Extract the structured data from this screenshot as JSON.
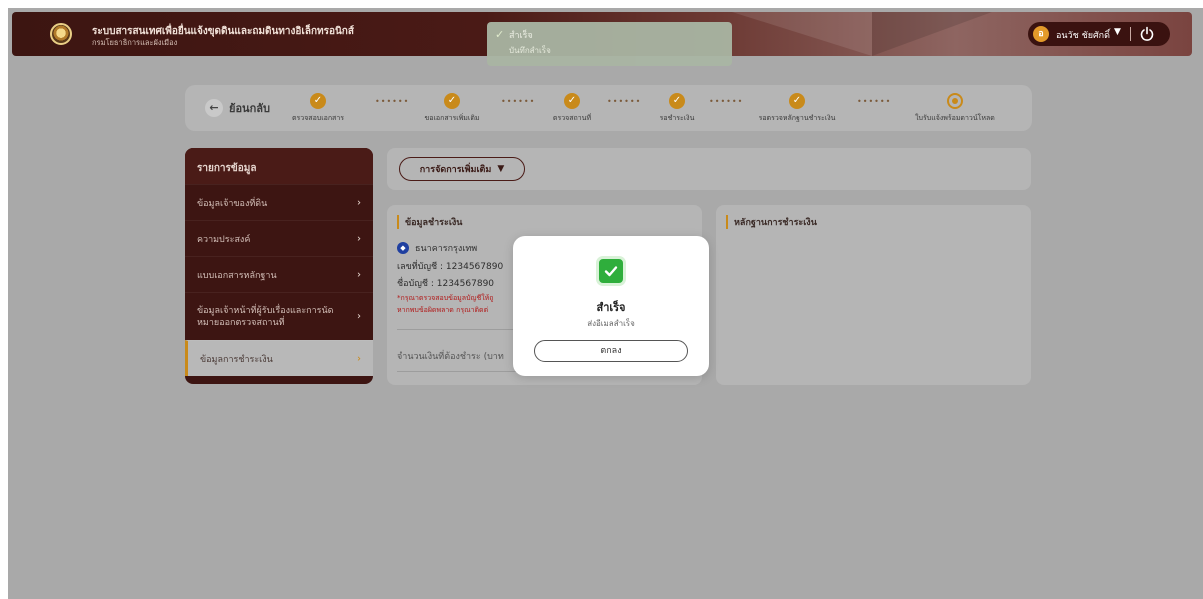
{
  "header": {
    "title": "ระบบสารสนเทศเพื่อยื่นแจ้งขุดดินและถมดินทางอิเล็กทรอนิกส์",
    "subtitle": "กรมโยธาธิการและผังเมือง",
    "user_initial": "อ",
    "user_name": "อนวัช ชัยศักดิ์"
  },
  "toast": {
    "title": "สำเร็จ",
    "message": "บันทึกสำเร็จ"
  },
  "stepper": {
    "back_label": "ย้อนกลับ",
    "steps": [
      {
        "label": "ตรวจสอบเอกสาร",
        "status": "done"
      },
      {
        "label": "ขอเอกสารเพิ่มเติม",
        "status": "done"
      },
      {
        "label": "ตรวจสถานที่",
        "status": "done"
      },
      {
        "label": "รอชำระเงิน",
        "status": "done"
      },
      {
        "label": "รอตรวจหลักฐานชำระเงิน",
        "status": "done"
      },
      {
        "label": "ใบรับแจ้งพร้อมดาวน์โหลด",
        "status": "current"
      }
    ]
  },
  "sidebar": {
    "heading": "รายการข้อมูล",
    "items": [
      {
        "label": "ข้อมูลเจ้าของที่ดิน"
      },
      {
        "label": "ความประสงค์"
      },
      {
        "label": "แบบเอกสารหลักฐาน"
      },
      {
        "label": "ข้อมูลเจ้าหน้าที่ผู้รับเรื่องและการนัดหมายออกตรวจสถานที่"
      },
      {
        "label": "ข้อมูลการชำระเงิน",
        "active": true
      }
    ]
  },
  "actions": {
    "manage_label": "การจัดการเพิ่มเติม"
  },
  "payment_card": {
    "title": "ข้อมูลชำระเงิน",
    "bank_name": "ธนาคารกรุงเทพ",
    "account_no": "เลขที่บัญชี : 1234567890",
    "account_name": "ชื่อบัญชี : 1234567890",
    "note1": "*กรุณาตรวจสอบข้อมูลบัญชีให้ถู",
    "note2": "หากพบข้อผิดพลาด กรุณาติดต่",
    "amount_label": "จำนวนเงินที่ต้องชำระ (บาท"
  },
  "evidence_card": {
    "title": "หลักฐานการชำระเงิน"
  },
  "modal": {
    "title": "สำเร็จ",
    "message": "ส่งอีเมลสำเร็จ",
    "ok_label": "ตกลง"
  },
  "colors": {
    "brand_dark": "#3d1512",
    "accent": "#c98a1a",
    "success": "#2fae3c"
  }
}
